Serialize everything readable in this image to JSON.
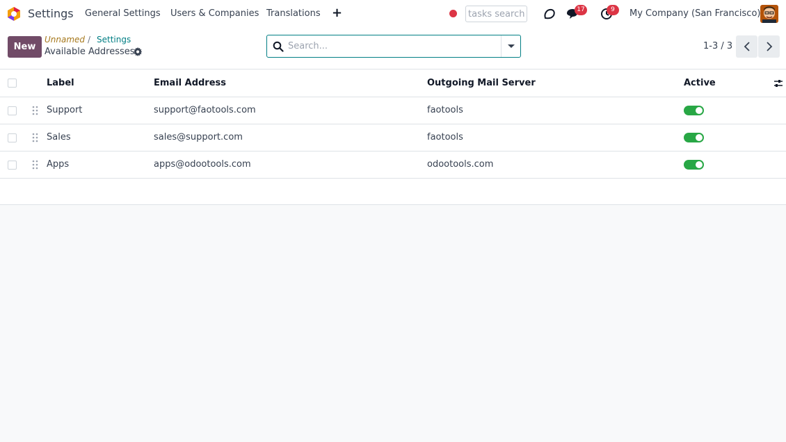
{
  "navbar": {
    "app_name": "Settings",
    "menu": [
      "General Settings",
      "Users & Companies",
      "Translations"
    ],
    "tasks_search_placeholder": "tasks search",
    "messages_count": "17",
    "activities_count": "9",
    "company": "My Company (San Francisco)"
  },
  "control": {
    "new_label": "New",
    "breadcrumb": [
      "Unnamed",
      "Settings"
    ],
    "breadcrumb_sep": "/",
    "title": "Available Addresses",
    "search_placeholder": "Search...",
    "pager": "1-3 / 3"
  },
  "table": {
    "columns": [
      "Label",
      "Email Address",
      "Outgoing Mail Server",
      "Active"
    ],
    "rows": [
      {
        "label": "Support",
        "email": "support@faotools.com",
        "server": "faotools",
        "active": true
      },
      {
        "label": "Sales",
        "email": "sales@support.com",
        "server": "faotools",
        "active": true
      },
      {
        "label": "Apps",
        "email": "apps@odootools.com",
        "server": "odootools.com",
        "active": true
      }
    ]
  },
  "colors": {
    "brand": "#714b67",
    "accent": "#017e84",
    "toggle_on": "#28a745",
    "badge": "#dc3545"
  }
}
